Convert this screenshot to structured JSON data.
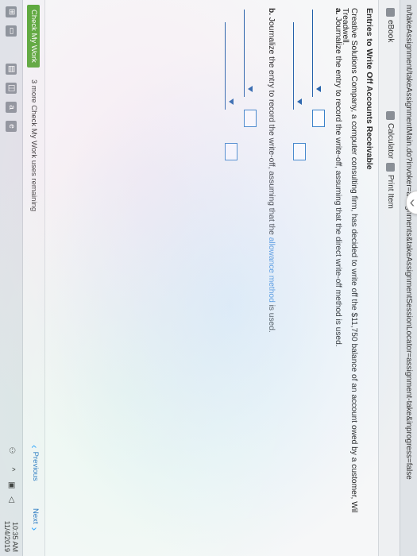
{
  "browser": {
    "url": "m/takeAssignment/takeAssignmentMain.do?invoker=assignments&takeAssignmentSessionLocator=assignment-take&inprogress=false"
  },
  "toolbar": {
    "ebook": "eBook",
    "calculator": "Calculator",
    "print": "Print Item"
  },
  "question": {
    "title": "Entries to Write Off Accounts Receivable",
    "prompt_start": "Creative Solutions Company, a computer consulting firm, has decided to write off the $11,750 balance of an account owed by a customer, Wil Treadwell.",
    "part_a_letter": "a.",
    "part_a_text": "Journalize the entry to record the write-off, assuming that the direct write-off method is used.",
    "part_b_letter": "b.",
    "part_b_text_1": "Journalize the entry to record the write-off, assuming that the",
    "part_b_highlight": "allowance method",
    "part_b_text_2": "is used."
  },
  "footer": {
    "check_button": "Check My Work",
    "remaining": "3 more Check My Work uses remaining",
    "previous": "Previous",
    "next": "Next"
  },
  "taskbar": {
    "time": "10:35 AM",
    "date": "11/4/2019",
    "icons": [
      "start-icon",
      "task-view-icon",
      "file-explorer-icon",
      "store-icon",
      "mail-icon",
      "edge-icon"
    ]
  },
  "colors": {
    "accent_blue": "#1f5ea8",
    "link_blue": "#2a7fd8",
    "check_green": "#5aa83a"
  }
}
